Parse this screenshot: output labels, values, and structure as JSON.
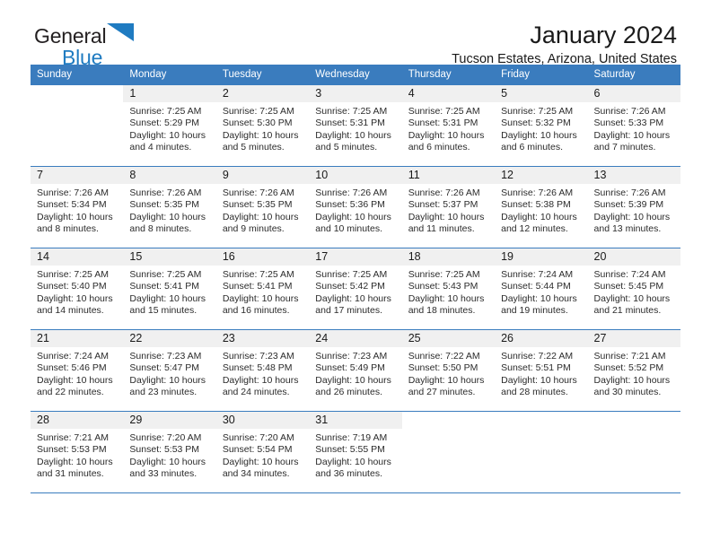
{
  "brand": {
    "line1": "General",
    "line2": "Blue",
    "triangle_color": "#1f7bc1",
    "text_color": "#231f20"
  },
  "header": {
    "title": "January 2024",
    "subtitle": "Tucson Estates, Arizona, United States"
  },
  "theme": {
    "header_bg": "#3a7cbe",
    "header_text": "#ffffff",
    "daynum_bg": "#f0f0f0",
    "rule_color": "#3a7cbe",
    "body_text": "#2b2b2b"
  },
  "weekday_headers": [
    "Sunday",
    "Monday",
    "Tuesday",
    "Wednesday",
    "Thursday",
    "Friday",
    "Saturday"
  ],
  "weeks": [
    [
      {
        "day": "",
        "sunrise": "",
        "sunset": "",
        "daylight1": "",
        "daylight2": ""
      },
      {
        "day": "1",
        "sunrise": "Sunrise: 7:25 AM",
        "sunset": "Sunset: 5:29 PM",
        "daylight1": "Daylight: 10 hours",
        "daylight2": "and 4 minutes."
      },
      {
        "day": "2",
        "sunrise": "Sunrise: 7:25 AM",
        "sunset": "Sunset: 5:30 PM",
        "daylight1": "Daylight: 10 hours",
        "daylight2": "and 5 minutes."
      },
      {
        "day": "3",
        "sunrise": "Sunrise: 7:25 AM",
        "sunset": "Sunset: 5:31 PM",
        "daylight1": "Daylight: 10 hours",
        "daylight2": "and 5 minutes."
      },
      {
        "day": "4",
        "sunrise": "Sunrise: 7:25 AM",
        "sunset": "Sunset: 5:31 PM",
        "daylight1": "Daylight: 10 hours",
        "daylight2": "and 6 minutes."
      },
      {
        "day": "5",
        "sunrise": "Sunrise: 7:25 AM",
        "sunset": "Sunset: 5:32 PM",
        "daylight1": "Daylight: 10 hours",
        "daylight2": "and 6 minutes."
      },
      {
        "day": "6",
        "sunrise": "Sunrise: 7:26 AM",
        "sunset": "Sunset: 5:33 PM",
        "daylight1": "Daylight: 10 hours",
        "daylight2": "and 7 minutes."
      }
    ],
    [
      {
        "day": "7",
        "sunrise": "Sunrise: 7:26 AM",
        "sunset": "Sunset: 5:34 PM",
        "daylight1": "Daylight: 10 hours",
        "daylight2": "and 8 minutes."
      },
      {
        "day": "8",
        "sunrise": "Sunrise: 7:26 AM",
        "sunset": "Sunset: 5:35 PM",
        "daylight1": "Daylight: 10 hours",
        "daylight2": "and 8 minutes."
      },
      {
        "day": "9",
        "sunrise": "Sunrise: 7:26 AM",
        "sunset": "Sunset: 5:35 PM",
        "daylight1": "Daylight: 10 hours",
        "daylight2": "and 9 minutes."
      },
      {
        "day": "10",
        "sunrise": "Sunrise: 7:26 AM",
        "sunset": "Sunset: 5:36 PM",
        "daylight1": "Daylight: 10 hours",
        "daylight2": "and 10 minutes."
      },
      {
        "day": "11",
        "sunrise": "Sunrise: 7:26 AM",
        "sunset": "Sunset: 5:37 PM",
        "daylight1": "Daylight: 10 hours",
        "daylight2": "and 11 minutes."
      },
      {
        "day": "12",
        "sunrise": "Sunrise: 7:26 AM",
        "sunset": "Sunset: 5:38 PM",
        "daylight1": "Daylight: 10 hours",
        "daylight2": "and 12 minutes."
      },
      {
        "day": "13",
        "sunrise": "Sunrise: 7:26 AM",
        "sunset": "Sunset: 5:39 PM",
        "daylight1": "Daylight: 10 hours",
        "daylight2": "and 13 minutes."
      }
    ],
    [
      {
        "day": "14",
        "sunrise": "Sunrise: 7:25 AM",
        "sunset": "Sunset: 5:40 PM",
        "daylight1": "Daylight: 10 hours",
        "daylight2": "and 14 minutes."
      },
      {
        "day": "15",
        "sunrise": "Sunrise: 7:25 AM",
        "sunset": "Sunset: 5:41 PM",
        "daylight1": "Daylight: 10 hours",
        "daylight2": "and 15 minutes."
      },
      {
        "day": "16",
        "sunrise": "Sunrise: 7:25 AM",
        "sunset": "Sunset: 5:41 PM",
        "daylight1": "Daylight: 10 hours",
        "daylight2": "and 16 minutes."
      },
      {
        "day": "17",
        "sunrise": "Sunrise: 7:25 AM",
        "sunset": "Sunset: 5:42 PM",
        "daylight1": "Daylight: 10 hours",
        "daylight2": "and 17 minutes."
      },
      {
        "day": "18",
        "sunrise": "Sunrise: 7:25 AM",
        "sunset": "Sunset: 5:43 PM",
        "daylight1": "Daylight: 10 hours",
        "daylight2": "and 18 minutes."
      },
      {
        "day": "19",
        "sunrise": "Sunrise: 7:24 AM",
        "sunset": "Sunset: 5:44 PM",
        "daylight1": "Daylight: 10 hours",
        "daylight2": "and 19 minutes."
      },
      {
        "day": "20",
        "sunrise": "Sunrise: 7:24 AM",
        "sunset": "Sunset: 5:45 PM",
        "daylight1": "Daylight: 10 hours",
        "daylight2": "and 21 minutes."
      }
    ],
    [
      {
        "day": "21",
        "sunrise": "Sunrise: 7:24 AM",
        "sunset": "Sunset: 5:46 PM",
        "daylight1": "Daylight: 10 hours",
        "daylight2": "and 22 minutes."
      },
      {
        "day": "22",
        "sunrise": "Sunrise: 7:23 AM",
        "sunset": "Sunset: 5:47 PM",
        "daylight1": "Daylight: 10 hours",
        "daylight2": "and 23 minutes."
      },
      {
        "day": "23",
        "sunrise": "Sunrise: 7:23 AM",
        "sunset": "Sunset: 5:48 PM",
        "daylight1": "Daylight: 10 hours",
        "daylight2": "and 24 minutes."
      },
      {
        "day": "24",
        "sunrise": "Sunrise: 7:23 AM",
        "sunset": "Sunset: 5:49 PM",
        "daylight1": "Daylight: 10 hours",
        "daylight2": "and 26 minutes."
      },
      {
        "day": "25",
        "sunrise": "Sunrise: 7:22 AM",
        "sunset": "Sunset: 5:50 PM",
        "daylight1": "Daylight: 10 hours",
        "daylight2": "and 27 minutes."
      },
      {
        "day": "26",
        "sunrise": "Sunrise: 7:22 AM",
        "sunset": "Sunset: 5:51 PM",
        "daylight1": "Daylight: 10 hours",
        "daylight2": "and 28 minutes."
      },
      {
        "day": "27",
        "sunrise": "Sunrise: 7:21 AM",
        "sunset": "Sunset: 5:52 PM",
        "daylight1": "Daylight: 10 hours",
        "daylight2": "and 30 minutes."
      }
    ],
    [
      {
        "day": "28",
        "sunrise": "Sunrise: 7:21 AM",
        "sunset": "Sunset: 5:53 PM",
        "daylight1": "Daylight: 10 hours",
        "daylight2": "and 31 minutes."
      },
      {
        "day": "29",
        "sunrise": "Sunrise: 7:20 AM",
        "sunset": "Sunset: 5:53 PM",
        "daylight1": "Daylight: 10 hours",
        "daylight2": "and 33 minutes."
      },
      {
        "day": "30",
        "sunrise": "Sunrise: 7:20 AM",
        "sunset": "Sunset: 5:54 PM",
        "daylight1": "Daylight: 10 hours",
        "daylight2": "and 34 minutes."
      },
      {
        "day": "31",
        "sunrise": "Sunrise: 7:19 AM",
        "sunset": "Sunset: 5:55 PM",
        "daylight1": "Daylight: 10 hours",
        "daylight2": "and 36 minutes."
      },
      {
        "day": "",
        "sunrise": "",
        "sunset": "",
        "daylight1": "",
        "daylight2": ""
      },
      {
        "day": "",
        "sunrise": "",
        "sunset": "",
        "daylight1": "",
        "daylight2": ""
      },
      {
        "day": "",
        "sunrise": "",
        "sunset": "",
        "daylight1": "",
        "daylight2": ""
      }
    ]
  ]
}
